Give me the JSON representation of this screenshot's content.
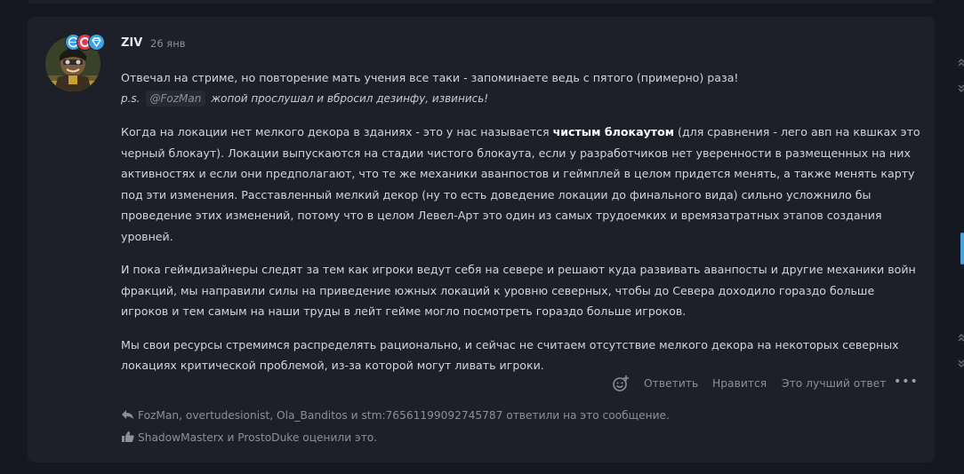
{
  "post": {
    "author": "ZIV",
    "date": "26 янв",
    "line1": "Отвечал на стриме, но повторение мать учения все таки - запоминаете ведь с пятого (примерно) раза!",
    "ps_prefix": "p.s.",
    "ps_mention": "@FozMan",
    "ps_rest": "жопой прослушал и вбросил дезинфу, извинись!",
    "para1_a": "Когда на локации нет мелкого декора в зданиях - это у нас называется ",
    "para1_bold": "чистым блокаутом",
    "para1_b": " (для сравнения - лего авп на квшках это черный блокаут). Локации выпускаются на стадии чистого блокаута, если у разработчиков нет уверенности в размещенных на них активностях и если они предполагают, что те же механики аванпостов и геймплей в целом придется менять, а также менять карту под эти изменения. Расставленный мелкий декор (ну то есть доведение локации до финального вида) сильно усложнило бы проведение этих изменений, потому что в целом Левел-Арт это один из самых трудоемких и времязатратных этапов создания уровней.",
    "para2": "И пока геймдизайнеры следят за тем как игроки ведут себя на севере и решают куда развивать аванпосты и другие механики войн фракций, мы направили силы на приведение южных локаций к уровню северных, чтобы до Севера доходило гораздо больше игроков и тем самым на наши труды в лейт гейме могло посмотреть гораздо больше игроков.",
    "para3": "Мы свои ресурсы стремимся распределять рационально, и сейчас не считаем отсутствие мелкого декора на некоторых северных локациях критической проблемой, из-за которой могут ливать игроки."
  },
  "actions": {
    "reply": "Ответить",
    "like": "Нравится",
    "best_answer": "Это лучший ответ",
    "more": "•••"
  },
  "replies_line": "FozMan, overtudesionist, Ola_Banditos и stm:76561199092745787 ответили на это сообщение.",
  "likes_line": "ShadowMasterx и ProstoDuke оценили это.",
  "icons": {
    "reply_arrow": "reply-arrow-icon",
    "thumbs_up": "thumbs-up-icon",
    "add_reaction": "add-reaction-icon",
    "more": "more-icon"
  },
  "colors": {
    "background": "#151820",
    "card": "#1d2029",
    "text": "#d2d5da",
    "muted": "#8a8f99",
    "badge_blue": "#3aa0e8",
    "badge_red": "#e0394a"
  }
}
